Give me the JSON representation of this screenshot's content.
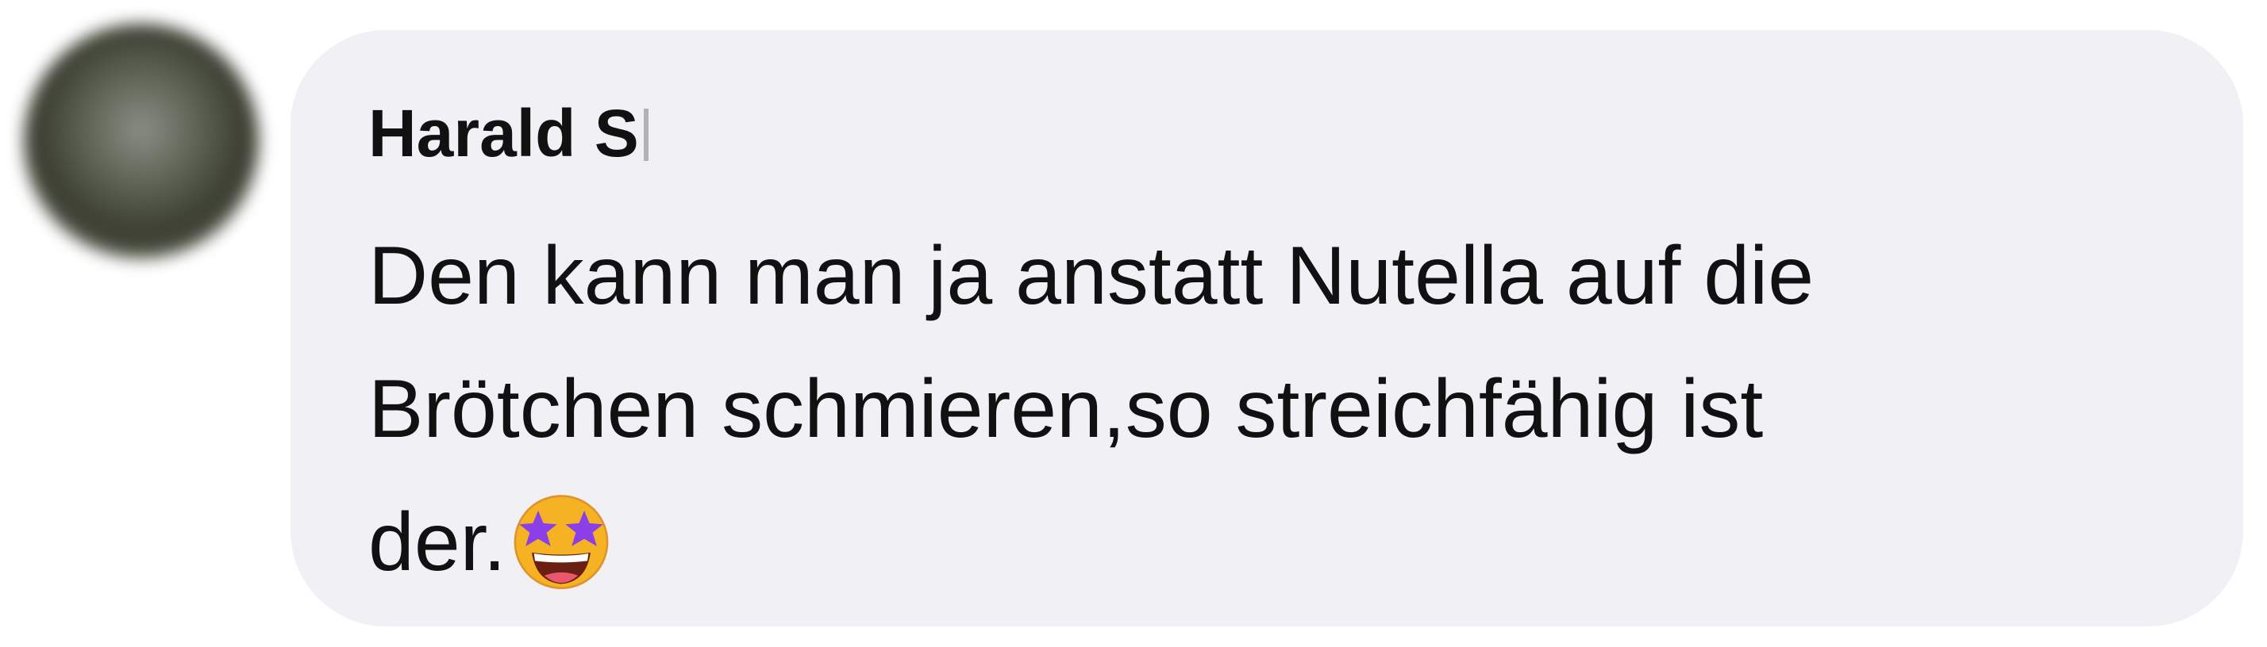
{
  "comment": {
    "author": "Harald S",
    "lines": [
      "Den kann man ja anstatt Nutella auf die",
      "Brötchen schmieren,so streichfähig ist",
      "der."
    ],
    "emoji_icon": "star-struck-emoji-icon"
  },
  "colors": {
    "bubble_background": "#f0f0f5",
    "text": "#111111"
  }
}
